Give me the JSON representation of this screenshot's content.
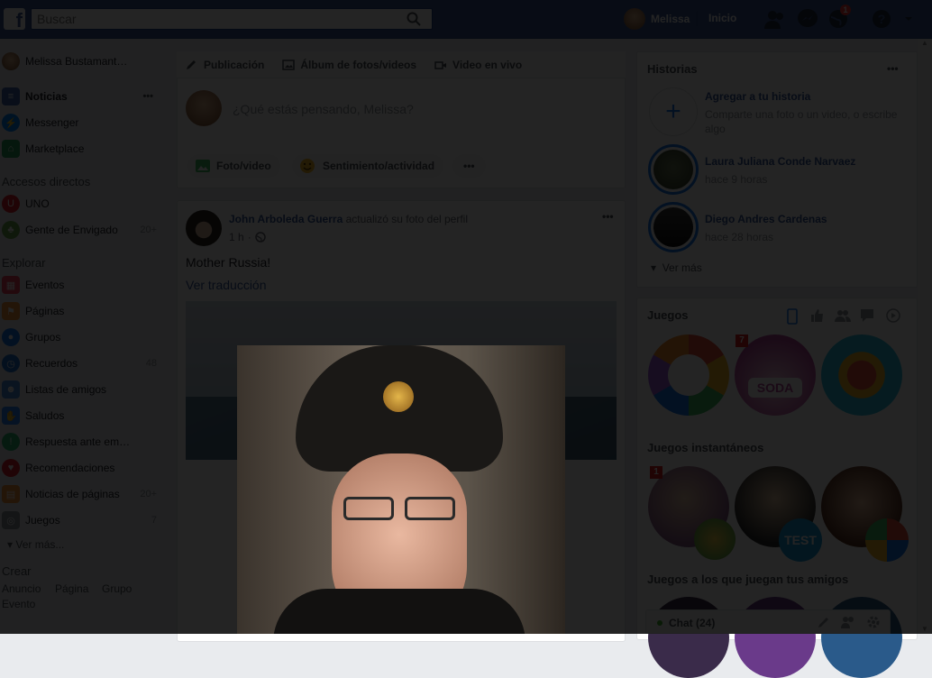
{
  "topbar": {
    "search_placeholder": "Buscar",
    "user_name": "Melissa",
    "home": "Inicio",
    "notif_count": "1"
  },
  "leftnav": {
    "profile": "Melissa Bustamant…",
    "items": [
      {
        "label": "Noticias",
        "icon": "news-icon",
        "more": "•••"
      },
      {
        "label": "Messenger",
        "icon": "messenger-icon"
      },
      {
        "label": "Marketplace",
        "icon": "marketplace-icon"
      }
    ],
    "shortcuts_title": "Accesos directos",
    "shortcuts": [
      {
        "label": "UNO",
        "icon": "uno-game-icon"
      },
      {
        "label": "Gente de Envigado",
        "icon": "group-tree-icon",
        "count": "20+"
      }
    ],
    "explore_title": "Explorar",
    "explore": [
      {
        "label": "Eventos",
        "icon": "calendar-icon"
      },
      {
        "label": "Páginas",
        "icon": "flag-icon"
      },
      {
        "label": "Grupos",
        "icon": "groups-icon"
      },
      {
        "label": "Recuerdos",
        "icon": "memories-icon",
        "count": "48"
      },
      {
        "label": "Listas de amigos",
        "icon": "friends-list-icon"
      },
      {
        "label": "Saludos",
        "icon": "wave-icon"
      },
      {
        "label": "Respuesta ante em…",
        "icon": "crisis-response-icon"
      },
      {
        "label": "Recomendaciones",
        "icon": "recommendations-icon"
      },
      {
        "label": "Noticias de páginas",
        "icon": "pages-feed-icon",
        "count": "20+"
      },
      {
        "label": "Juegos",
        "icon": "gamepad-icon",
        "count": "7"
      }
    ],
    "see_more": "Ver más...",
    "create_title": "Crear",
    "create_links": [
      "Anuncio",
      "Página",
      "Grupo",
      "Evento"
    ]
  },
  "composer": {
    "tabs": [
      "Publicación",
      "Álbum de fotos/videos",
      "Video en vivo"
    ],
    "prompt": "¿Qué estás pensando, Melissa?",
    "actions": [
      "Foto/video",
      "Sentimiento/actividad"
    ],
    "more": "•••"
  },
  "post": {
    "author": "John Arboleda Guerra",
    "action": "actualizó su foto del perfil",
    "time": "1 h",
    "text": "Mother Russia!",
    "translate": "Ver traducción",
    "more": "•••"
  },
  "right": {
    "stories_title": "Historias",
    "stories_more": "•••",
    "add_story_title": "Agregar a tu historia",
    "add_story_sub": "Comparte una foto o un video, o escribe algo",
    "stories": [
      {
        "name": "Laura Juliana Conde Narvaez",
        "time": "hace 9 horas"
      },
      {
        "name": "Diego Andres Cardenas",
        "time": "hace 28 horas"
      }
    ],
    "see_more": "Ver más",
    "games_title": "Juegos",
    "game_badge": "7",
    "instant_title": "Juegos instantáneos",
    "instant_badge": "1",
    "test_label": "TEST",
    "friends_games_title": "Juegos a los que juegan tus amigos",
    "chat_label": "Chat (24)"
  },
  "colors": {
    "brand": "#3b5998",
    "link": "#365899",
    "overlay": "rgba(0,0,0,0.86)"
  }
}
